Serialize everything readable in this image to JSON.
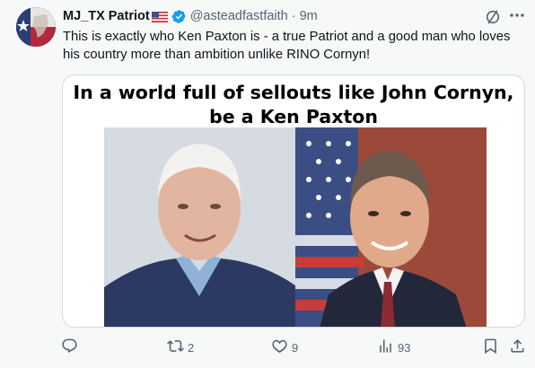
{
  "tweet": {
    "display_name": "MJ_TX Patriot",
    "handle": "@asteadfastfaith",
    "separator": "·",
    "time": "9m",
    "text": "This is exactly who Ken Paxton is - a true Patriot and a good man who loves his country more than ambition unlike RINO Cornyn!",
    "media": {
      "title": "In a world full of sellouts like John Cornyn, be a Ken Paxton"
    }
  },
  "actions": {
    "reply_count": "",
    "retweet_count": "2",
    "like_count": "9",
    "view_count": "93"
  },
  "colors": {
    "verified_blue": "#1d9bf0",
    "muted": "#536471",
    "background": "#f7f9f9"
  },
  "icons": [
    "avatar",
    "us-flag-icon",
    "verified-badge-icon",
    "grok-icon",
    "more-icon",
    "reply-icon",
    "retweet-icon",
    "like-icon",
    "views-icon",
    "bookmark-icon",
    "share-icon"
  ]
}
